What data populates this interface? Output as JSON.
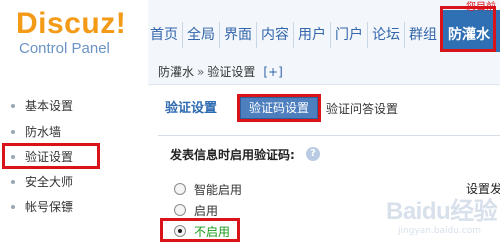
{
  "header": {
    "logo_title": "Discuz!",
    "logo_subtitle": "Control Panel",
    "greeting": "您目前",
    "nav": [
      {
        "label": "首页"
      },
      {
        "label": "全局"
      },
      {
        "label": "界面"
      },
      {
        "label": "内容"
      },
      {
        "label": "用户"
      },
      {
        "label": "门户"
      },
      {
        "label": "论坛"
      },
      {
        "label": "群组"
      }
    ],
    "active_nav": "防灌水"
  },
  "sidebar": {
    "items": [
      {
        "label": "基本设置"
      },
      {
        "label": "防水墙"
      },
      {
        "label": "验证设置"
      },
      {
        "label": "安全大师"
      },
      {
        "label": "帐号保镖"
      }
    ]
  },
  "breadcrumb": {
    "parent": "防灌水",
    "separator": "»",
    "current": "验证设置",
    "add": "[+]"
  },
  "tabs": {
    "title": "验证设置",
    "active": "验证码设置",
    "other": "验证问答设置"
  },
  "form": {
    "label": "发表信息时启用验证码:",
    "help_icon": "?",
    "options": [
      {
        "label": "智能启用",
        "checked": false
      },
      {
        "label": "启用",
        "checked": false
      },
      {
        "label": "不启用",
        "checked": true
      }
    ],
    "side_note": "设置发"
  },
  "watermark": {
    "text": "Baidu经验",
    "sub": "jingyan.baidu.com"
  },
  "colors": {
    "brand_orange": "#f39a17",
    "link_blue": "#3366aa",
    "active_blue": "#2f6fb4",
    "highlight_red": "#d9131a",
    "selected_green": "#1a9c1a"
  }
}
